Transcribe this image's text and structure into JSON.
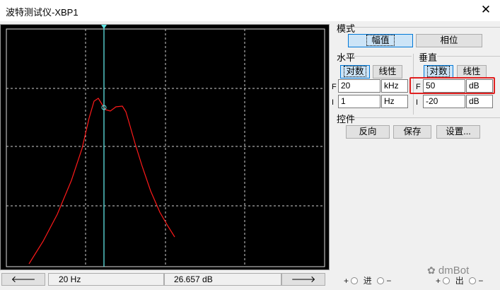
{
  "window": {
    "title": "波特测试仪-XBP1",
    "close_glyph": "✕"
  },
  "mode": {
    "label": "模式",
    "magnitude": "幅值",
    "phase": "相位"
  },
  "horizontal": {
    "label": "水平",
    "log": "对数",
    "lin": "线性",
    "f_label": "F",
    "i_label": "I",
    "f_value": "20",
    "f_unit": "kHz",
    "i_value": "1",
    "i_unit": "Hz"
  },
  "vertical": {
    "label": "垂直",
    "log": "对数",
    "lin": "线性",
    "f_label": "F",
    "i_label": "I",
    "f_value": "50",
    "f_unit": "dB",
    "i_value": "-20",
    "i_unit": "dB"
  },
  "controls": {
    "label": "控件",
    "reverse": "反向",
    "save": "保存",
    "settings": "设置..."
  },
  "readout": {
    "freq": "20  Hz",
    "gain": "26.657 dB",
    "left_arrow": "🡐",
    "right_arrow": "🡒"
  },
  "io": {
    "plus": "+",
    "minus": "−",
    "in": "进",
    "out": "出"
  },
  "watermark": "dmBot",
  "colors": {
    "trace": "#ff1a1a",
    "cursor": "#5fe3e3",
    "highlight": "#e02020"
  }
}
